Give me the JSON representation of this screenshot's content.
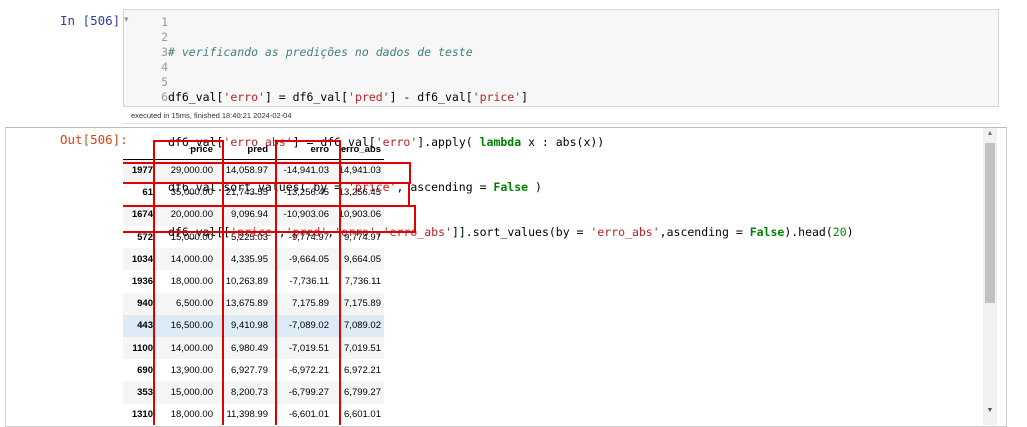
{
  "input": {
    "prompt": "In [506]:",
    "collapse_icon": "▾",
    "line_numbers": [
      "1",
      "2",
      "3",
      "4",
      "5",
      "6"
    ],
    "line1": "# verificando as predições no dados de teste",
    "line2": {
      "a": "df6_val[",
      "s1": "'erro'",
      "b": "] = df6_val[",
      "s2": "'pred'",
      "c": "] - df6_val[",
      "s3": "'price'",
      "d": "]"
    },
    "line3": {
      "a": "df6_val[",
      "s1": "'erro_abs'",
      "b": "] = df6_val[",
      "s2": "'erro'",
      "c": "].apply( ",
      "kw": "lambda",
      "d": " x : abs(x))"
    },
    "line4": {
      "a": "df6_val.sort_values( by = ",
      "s1": "'price'",
      "b": ", ascending = ",
      "kw": "False",
      "c": " )"
    },
    "line5": {
      "a": "df6_val[[",
      "s1": "'price'",
      "b": ",",
      "s2": "'pred'",
      "c": ",",
      "s3": "'erro'",
      "d": ",",
      "s4": "'erro_abs'",
      "e": "]].sort_values(by = ",
      "s5": "'erro_abs'",
      "f": ",ascending = ",
      "kw": "False",
      "g": ").head(",
      "n": "20",
      "h": ")"
    },
    "exec_info": "executed in 15ms, finished 18:40:21 2024-02-04"
  },
  "output": {
    "prompt": "Out[506]:",
    "columns": [
      "price",
      "pred",
      "erro",
      "erro_abs"
    ],
    "rows": [
      {
        "index": "1977",
        "price": "29,000.00",
        "pred": "14,058.97",
        "erro": "-14,941.03",
        "erro_abs": "14,941.03"
      },
      {
        "index": "61",
        "price": "35,000.00",
        "pred": "21,743.55",
        "erro": "-13,256.45",
        "erro_abs": "13,256.45"
      },
      {
        "index": "1674",
        "price": "20,000.00",
        "pred": "9,096.94",
        "erro": "-10,903.06",
        "erro_abs": "10,903.06"
      },
      {
        "index": "572",
        "price": "15,000.00",
        "pred": "5,225.03",
        "erro": "-9,774.97",
        "erro_abs": "9,774.97"
      },
      {
        "index": "1034",
        "price": "14,000.00",
        "pred": "4,335.95",
        "erro": "-9,664.05",
        "erro_abs": "9,664.05"
      },
      {
        "index": "1936",
        "price": "18,000.00",
        "pred": "10,263.89",
        "erro": "-7,736.11",
        "erro_abs": "7,736.11"
      },
      {
        "index": "940",
        "price": "6,500.00",
        "pred": "13,675.89",
        "erro": "7,175.89",
        "erro_abs": "7,175.89"
      },
      {
        "index": "443",
        "price": "16,500.00",
        "pred": "9,410.98",
        "erro": "-7,089.02",
        "erro_abs": "7,089.02"
      },
      {
        "index": "1100",
        "price": "14,000.00",
        "pred": "6,980.49",
        "erro": "-7,019.51",
        "erro_abs": "7,019.51"
      },
      {
        "index": "690",
        "price": "13,900.00",
        "pred": "6,927.79",
        "erro": "-6,972.21",
        "erro_abs": "6,972.21"
      },
      {
        "index": "353",
        "price": "15,000.00",
        "pred": "8,200.73",
        "erro": "-6,799.27",
        "erro_abs": "6,799.27"
      },
      {
        "index": "1310",
        "price": "18,000.00",
        "pred": "11,398.99",
        "erro": "-6,601.01",
        "erro_abs": "6,601.01"
      }
    ]
  },
  "scrollbar": {
    "up_icon": "▲",
    "down_icon": "▼"
  },
  "colors": {
    "annotation": "#e00000",
    "in_prompt": "#303f9f",
    "out_prompt": "#d84315",
    "hover_row": "#dcebf6"
  }
}
